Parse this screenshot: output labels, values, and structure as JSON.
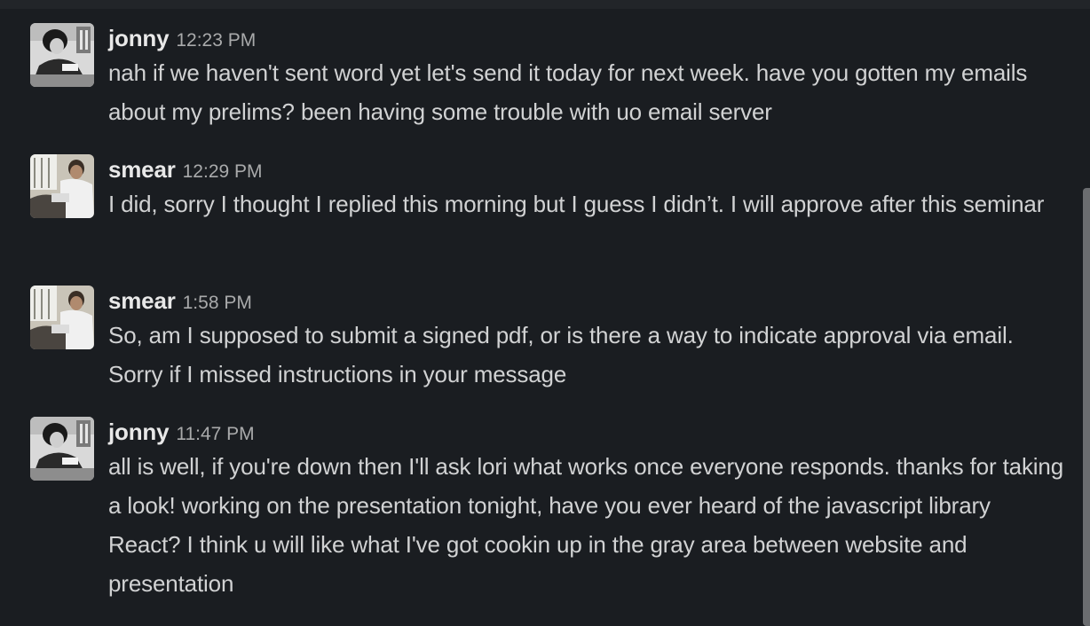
{
  "messages": [
    {
      "author": "jonny",
      "time": "12:23 PM",
      "avatar_icon": "user-avatar-jonny",
      "text": "nah if we haven't sent word yet let's send it today for next week. have you gotten my emails about my prelims? been having some trouble with uo email server"
    },
    {
      "author": "smear",
      "time": "12:29 PM",
      "avatar_icon": "user-avatar-smear",
      "text": "I did, sorry I thought I replied this morning but I guess I didn’t. I will approve after this seminar"
    },
    {
      "author": "smear",
      "time": "1:58 PM",
      "avatar_icon": "user-avatar-smear",
      "text": "So, am I supposed to submit a signed pdf, or is there a way to indicate approval via email. Sorry if I missed instructions in your message"
    },
    {
      "author": "jonny",
      "time": "11:47 PM",
      "avatar_icon": "user-avatar-jonny",
      "text": "all is well, if you're down then I'll ask lori what works once everyone responds. thanks for taking a look! working on the presentation tonight, have you ever heard of the javascript library React? I think u will like what I've got cookin up in the gray area between website and presentation"
    }
  ],
  "colors": {
    "background": "#1a1d21",
    "text": "#d1d2d3",
    "author": "#e8e8e8",
    "timestamp": "#a9aaab"
  }
}
